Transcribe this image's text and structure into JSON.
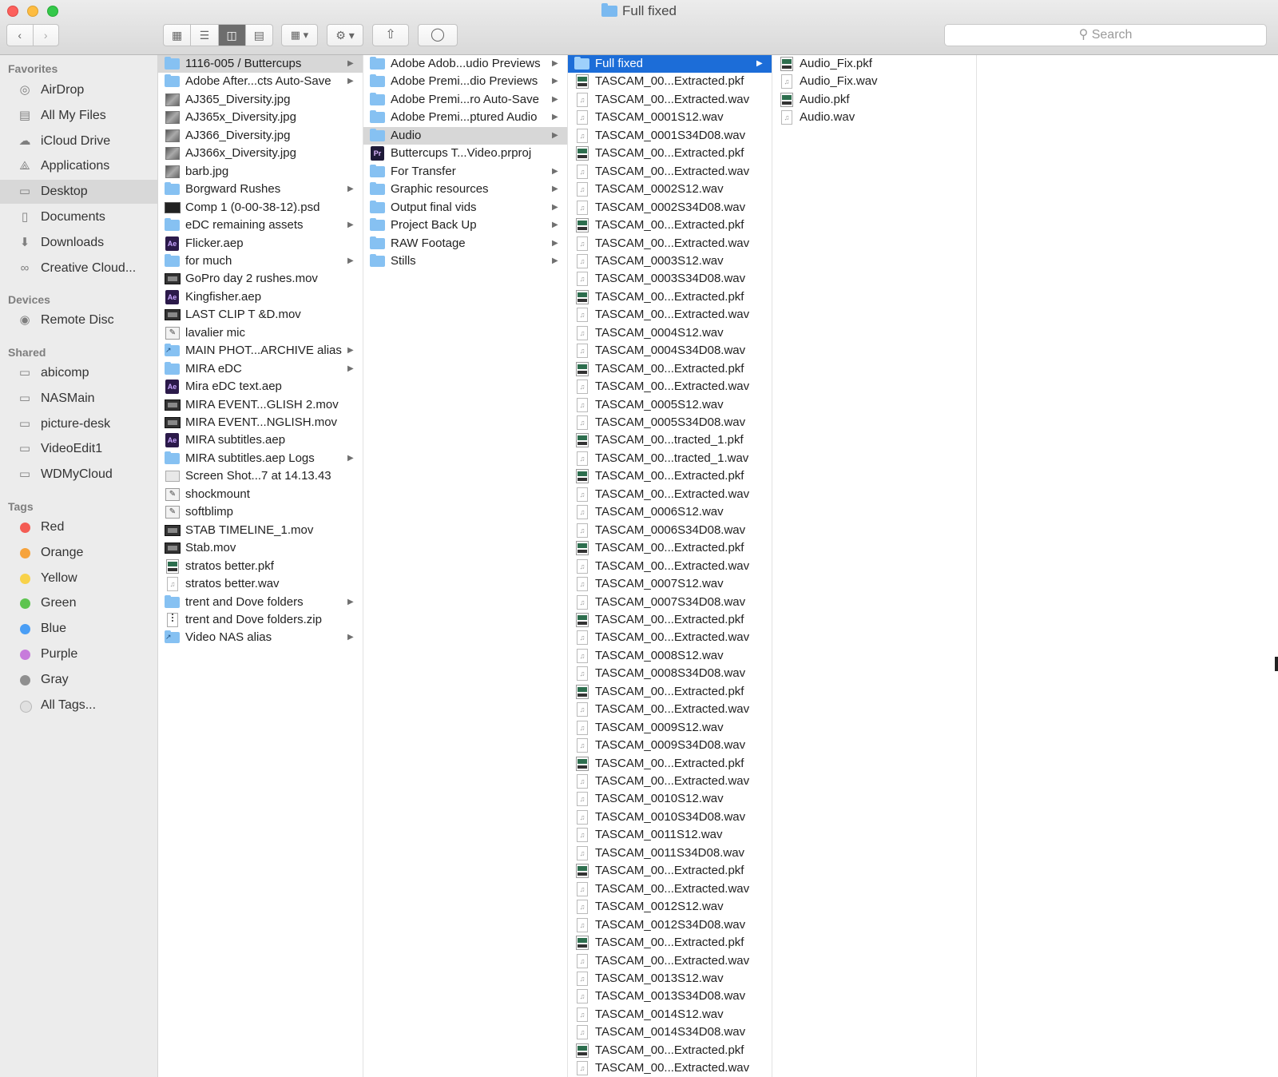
{
  "window": {
    "title": "Full fixed"
  },
  "toolbar": {
    "back_icon": "chevron-left-icon",
    "forward_icon": "chevron-right-icon",
    "view_modes": [
      "icon-view",
      "list-view",
      "column-view",
      "cover-flow-view"
    ],
    "active_view": "column-view",
    "search_placeholder": "Search"
  },
  "sidebar": {
    "favorites_header": "Favorites",
    "favorites": [
      {
        "label": "AirDrop",
        "icon": "airdrop-icon"
      },
      {
        "label": "All My Files",
        "icon": "all-files-icon"
      },
      {
        "label": "iCloud Drive",
        "icon": "cloud-icon"
      },
      {
        "label": "Applications",
        "icon": "applications-icon"
      },
      {
        "label": "Desktop",
        "icon": "desktop-icon",
        "selected": true
      },
      {
        "label": "Documents",
        "icon": "documents-icon"
      },
      {
        "label": "Downloads",
        "icon": "downloads-icon"
      },
      {
        "label": "Creative Cloud...",
        "icon": "creative-cloud-icon"
      }
    ],
    "devices_header": "Devices",
    "devices": [
      {
        "label": "Remote Disc",
        "icon": "disc-icon"
      }
    ],
    "shared_header": "Shared",
    "shared": [
      {
        "label": "abicomp",
        "icon": "computer-icon"
      },
      {
        "label": "NASMain",
        "icon": "computer-icon"
      },
      {
        "label": "picture-desk",
        "icon": "computer-icon"
      },
      {
        "label": "VideoEdit1",
        "icon": "computer-icon"
      },
      {
        "label": "WDMyCloud",
        "icon": "computer-icon"
      }
    ],
    "tags_header": "Tags",
    "tags": [
      {
        "label": "Red",
        "color": "#f45c54"
      },
      {
        "label": "Orange",
        "color": "#f6a33c"
      },
      {
        "label": "Yellow",
        "color": "#f8d24a"
      },
      {
        "label": "Green",
        "color": "#5ec450"
      },
      {
        "label": "Blue",
        "color": "#4a9ef5"
      },
      {
        "label": "Purple",
        "color": "#c77bdb"
      },
      {
        "label": "Gray",
        "color": "#8f8f8f"
      },
      {
        "label": "All Tags...",
        "color": "#e0e0e0"
      }
    ]
  },
  "columns": {
    "col1": [
      {
        "label": "1116-005 / Buttercups",
        "type": "folder",
        "arrow": true,
        "selected": "gray"
      },
      {
        "label": "Adobe After...cts Auto-Save",
        "type": "folder",
        "arrow": true
      },
      {
        "label": "AJ365_Diversity.jpg",
        "type": "img"
      },
      {
        "label": "AJ365x_Diversity.jpg",
        "type": "img"
      },
      {
        "label": "AJ366_Diversity.jpg",
        "type": "img"
      },
      {
        "label": "AJ366x_Diversity.jpg",
        "type": "img"
      },
      {
        "label": "barb.jpg",
        "type": "img"
      },
      {
        "label": "Borgward Rushes",
        "type": "folder",
        "arrow": true
      },
      {
        "label": "Comp 1 (0-00-38-12).psd",
        "type": "psd"
      },
      {
        "label": "eDC remaining assets",
        "type": "folder",
        "arrow": true
      },
      {
        "label": "Flicker.aep",
        "type": "ae"
      },
      {
        "label": "for much",
        "type": "folder",
        "arrow": true
      },
      {
        "label": "GoPro day 2 rushes.mov",
        "type": "mov"
      },
      {
        "label": "Kingfisher.aep",
        "type": "ae"
      },
      {
        "label": "LAST CLIP T &D.mov",
        "type": "mov"
      },
      {
        "label": "lavalier mic",
        "type": "misc"
      },
      {
        "label": "MAIN PHOT...ARCHIVE alias",
        "type": "alias",
        "arrow": true
      },
      {
        "label": "MIRA eDC",
        "type": "folder",
        "arrow": true
      },
      {
        "label": "Mira eDC text.aep",
        "type": "ae"
      },
      {
        "label": "MIRA EVENT...GLISH 2.mov",
        "type": "mov"
      },
      {
        "label": "MIRA EVENT...NGLISH.mov",
        "type": "mov"
      },
      {
        "label": "MIRA subtitles.aep",
        "type": "ae"
      },
      {
        "label": "MIRA subtitles.aep Logs",
        "type": "folder",
        "arrow": true
      },
      {
        "label": "Screen Shot...7 at 14.13.43",
        "type": "shot"
      },
      {
        "label": "shockmount",
        "type": "misc"
      },
      {
        "label": "softblimp",
        "type": "misc"
      },
      {
        "label": "STAB TIMELINE_1.mov",
        "type": "mov"
      },
      {
        "label": "Stab.mov",
        "type": "mov"
      },
      {
        "label": "stratos better.pkf",
        "type": "pkf"
      },
      {
        "label": "stratos better.wav",
        "type": "doc"
      },
      {
        "label": "trent and Dove folders",
        "type": "folder",
        "arrow": true
      },
      {
        "label": "trent and Dove folders.zip",
        "type": "zip"
      },
      {
        "label": "Video NAS alias",
        "type": "alias",
        "arrow": true
      }
    ],
    "col2": [
      {
        "label": "Adobe Adob...udio Previews",
        "type": "folder",
        "arrow": true
      },
      {
        "label": "Adobe Premi...dio Previews",
        "type": "folder",
        "arrow": true
      },
      {
        "label": "Adobe Premi...ro Auto-Save",
        "type": "folder",
        "arrow": true
      },
      {
        "label": "Adobe Premi...ptured Audio",
        "type": "folder",
        "arrow": true
      },
      {
        "label": "Audio",
        "type": "folder",
        "arrow": true,
        "selected": "gray"
      },
      {
        "label": "Buttercups T...Video.prproj",
        "type": "pr"
      },
      {
        "label": "For Transfer",
        "type": "folder",
        "arrow": true
      },
      {
        "label": "Graphic resources",
        "type": "folder",
        "arrow": true
      },
      {
        "label": "Output final vids",
        "type": "folder",
        "arrow": true
      },
      {
        "label": "Project Back Up",
        "type": "folder",
        "arrow": true
      },
      {
        "label": "RAW Footage",
        "type": "folder",
        "arrow": true
      },
      {
        "label": "Stills",
        "type": "folder",
        "arrow": true
      }
    ],
    "col3": [
      {
        "label": "Full fixed",
        "type": "folder",
        "arrow": true,
        "selected": "blue"
      },
      {
        "label": "TASCAM_00...Extracted.pkf",
        "type": "pkf"
      },
      {
        "label": "TASCAM_00...Extracted.wav",
        "type": "doc"
      },
      {
        "label": "TASCAM_0001S12.wav",
        "type": "doc"
      },
      {
        "label": "TASCAM_0001S34D08.wav",
        "type": "doc"
      },
      {
        "label": "TASCAM_00...Extracted.pkf",
        "type": "pkf"
      },
      {
        "label": "TASCAM_00...Extracted.wav",
        "type": "doc"
      },
      {
        "label": "TASCAM_0002S12.wav",
        "type": "doc"
      },
      {
        "label": "TASCAM_0002S34D08.wav",
        "type": "doc"
      },
      {
        "label": "TASCAM_00...Extracted.pkf",
        "type": "pkf"
      },
      {
        "label": "TASCAM_00...Extracted.wav",
        "type": "doc"
      },
      {
        "label": "TASCAM_0003S12.wav",
        "type": "doc"
      },
      {
        "label": "TASCAM_0003S34D08.wav",
        "type": "doc"
      },
      {
        "label": "TASCAM_00...Extracted.pkf",
        "type": "pkf"
      },
      {
        "label": "TASCAM_00...Extracted.wav",
        "type": "doc"
      },
      {
        "label": "TASCAM_0004S12.wav",
        "type": "doc"
      },
      {
        "label": "TASCAM_0004S34D08.wav",
        "type": "doc"
      },
      {
        "label": "TASCAM_00...Extracted.pkf",
        "type": "pkf"
      },
      {
        "label": "TASCAM_00...Extracted.wav",
        "type": "doc"
      },
      {
        "label": "TASCAM_0005S12.wav",
        "type": "doc"
      },
      {
        "label": "TASCAM_0005S34D08.wav",
        "type": "doc"
      },
      {
        "label": "TASCAM_00...tracted_1.pkf",
        "type": "pkf"
      },
      {
        "label": "TASCAM_00...tracted_1.wav",
        "type": "doc"
      },
      {
        "label": "TASCAM_00...Extracted.pkf",
        "type": "pkf"
      },
      {
        "label": "TASCAM_00...Extracted.wav",
        "type": "doc"
      },
      {
        "label": "TASCAM_0006S12.wav",
        "type": "doc"
      },
      {
        "label": "TASCAM_0006S34D08.wav",
        "type": "doc"
      },
      {
        "label": "TASCAM_00...Extracted.pkf",
        "type": "pkf"
      },
      {
        "label": "TASCAM_00...Extracted.wav",
        "type": "doc"
      },
      {
        "label": "TASCAM_0007S12.wav",
        "type": "doc"
      },
      {
        "label": "TASCAM_0007S34D08.wav",
        "type": "doc"
      },
      {
        "label": "TASCAM_00...Extracted.pkf",
        "type": "pkf"
      },
      {
        "label": "TASCAM_00...Extracted.wav",
        "type": "doc"
      },
      {
        "label": "TASCAM_0008S12.wav",
        "type": "doc"
      },
      {
        "label": "TASCAM_0008S34D08.wav",
        "type": "doc"
      },
      {
        "label": "TASCAM_00...Extracted.pkf",
        "type": "pkf"
      },
      {
        "label": "TASCAM_00...Extracted.wav",
        "type": "doc"
      },
      {
        "label": "TASCAM_0009S12.wav",
        "type": "doc"
      },
      {
        "label": "TASCAM_0009S34D08.wav",
        "type": "doc"
      },
      {
        "label": "TASCAM_00...Extracted.pkf",
        "type": "pkf"
      },
      {
        "label": "TASCAM_00...Extracted.wav",
        "type": "doc"
      },
      {
        "label": "TASCAM_0010S12.wav",
        "type": "doc"
      },
      {
        "label": "TASCAM_0010S34D08.wav",
        "type": "doc"
      },
      {
        "label": "TASCAM_0011S12.wav",
        "type": "doc"
      },
      {
        "label": "TASCAM_0011S34D08.wav",
        "type": "doc"
      },
      {
        "label": "TASCAM_00...Extracted.pkf",
        "type": "pkf"
      },
      {
        "label": "TASCAM_00...Extracted.wav",
        "type": "doc"
      },
      {
        "label": "TASCAM_0012S12.wav",
        "type": "doc"
      },
      {
        "label": "TASCAM_0012S34D08.wav",
        "type": "doc"
      },
      {
        "label": "TASCAM_00...Extracted.pkf",
        "type": "pkf"
      },
      {
        "label": "TASCAM_00...Extracted.wav",
        "type": "doc"
      },
      {
        "label": "TASCAM_0013S12.wav",
        "type": "doc"
      },
      {
        "label": "TASCAM_0013S34D08.wav",
        "type": "doc"
      },
      {
        "label": "TASCAM_0014S12.wav",
        "type": "doc"
      },
      {
        "label": "TASCAM_0014S34D08.wav",
        "type": "doc"
      },
      {
        "label": "TASCAM_00...Extracted.pkf",
        "type": "pkf"
      },
      {
        "label": "TASCAM_00...Extracted.wav",
        "type": "doc"
      }
    ],
    "col4": [
      {
        "label": "Audio_Fix.pkf",
        "type": "pkf"
      },
      {
        "label": "Audio_Fix.wav",
        "type": "doc"
      },
      {
        "label": "Audio.pkf",
        "type": "pkf"
      },
      {
        "label": "Audio.wav",
        "type": "doc"
      }
    ]
  }
}
